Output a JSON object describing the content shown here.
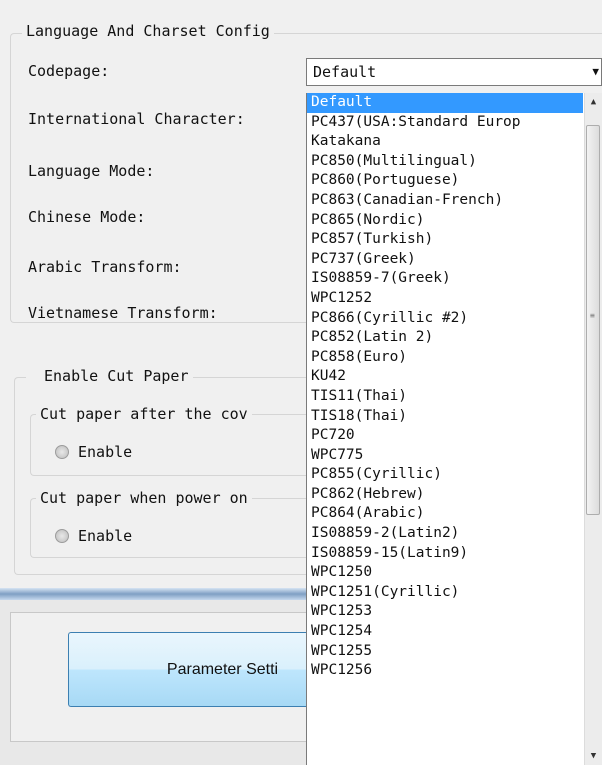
{
  "language_group": {
    "title": "Language And Charset Config",
    "labels": [
      "Codepage:",
      "International Character:",
      "Language Mode:",
      "Chinese Mode:",
      "Arabic Transform:",
      "Vietnamese Transform:"
    ],
    "codepage_value": "Default"
  },
  "cut_paper": {
    "checkbox_label": "Enable Cut Paper",
    "checked": true,
    "cover_group_title": "Cut paper after the cov",
    "cover_radio_label": "Enable",
    "power_group_title": "Cut paper when power on",
    "power_radio_label": "Enable"
  },
  "parameter_button": "Parameter Setti",
  "codepage_options": [
    "Default",
    "PC437(USA:Standard Europ",
    "Katakana",
    "PC850(Multilingual)",
    "PC860(Portuguese)",
    "PC863(Canadian-French)",
    "PC865(Nordic)",
    "PC857(Turkish)",
    "PC737(Greek)",
    "IS08859-7(Greek)",
    "WPC1252",
    "PC866(Cyrillic #2)",
    "PC852(Latin 2)",
    "PC858(Euro)",
    "KU42",
    "TIS11(Thai)",
    "TIS18(Thai)",
    "PC720",
    "WPC775",
    "PC855(Cyrillic)",
    "PC862(Hebrew)",
    "PC864(Arabic)",
    "IS08859-2(Latin2)",
    "IS08859-15(Latin9)",
    "WPC1250",
    "WPC1251(Cyrillic)",
    "WPC1253",
    "WPC1254",
    "WPC1255",
    "WPC1256"
  ],
  "selected_index": 0,
  "colors": {
    "selection": "#3399ff",
    "button_border": "#3c7fb1"
  }
}
